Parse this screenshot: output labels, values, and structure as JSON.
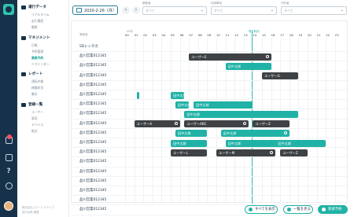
{
  "sidenav": {
    "sections": [
      {
        "title": "運行データ",
        "items": [
          "リアルタイム",
          "走行履歴",
          "動態"
        ]
      },
      {
        "title": "マネジメント",
        "items": [
          "日報",
          "予約管理",
          "乗務予約",
          "リマインダー"
        ]
      },
      {
        "title": "レポート",
        "items": [
          "運転作業",
          "稼働状況",
          "集計"
        ]
      },
      {
        "title": "登録一覧",
        "items": [
          "ユーザー",
          "車両",
          "デバイス",
          "拠点"
        ]
      }
    ],
    "active_item": "乗務予約",
    "footnote_company": "株式会社スマートドライブ",
    "footnote_user": "田中太郎 管理"
  },
  "filters": {
    "date": "2020-2-26（月）",
    "prev": "‹",
    "next": "›",
    "select1_label": "乗務者",
    "select1_value": "すべて",
    "select2_label": "利用車両",
    "select2_value": "すべて",
    "select3_label": "予約者",
    "select3_value": "すべて"
  },
  "timeline": {
    "column_header": "乗務者",
    "sub_label": "00時",
    "now_label": "現在時刻",
    "hours": [
      "00",
      "01",
      "02",
      "03",
      "04",
      "05",
      "06",
      "07",
      "08",
      "09",
      "10",
      "11",
      "12",
      "13",
      "14",
      "15",
      "16",
      "17",
      "18",
      "19",
      "20",
      "21",
      "22",
      "23"
    ],
    "rows": [
      "SDレンタカ",
      "品川営業012345",
      "品川営業012345",
      "品川営業012345",
      "品川営業012345",
      "品川営業012345",
      "品川営業012345",
      "品川営業012345",
      "品川営業012345",
      "品川営業012345",
      "品川営業012345",
      "品川営業012345",
      "品川営業012345",
      "品川営業012345",
      "品川営業012345",
      "品川営業012345",
      "品川営業012345",
      "品川営業012345",
      "品川営業012345"
    ],
    "bars": [
      {
        "row": 1,
        "start": 7,
        "end": 16,
        "label": "ユーザーE",
        "color": "dark",
        "icon": true
      },
      {
        "row": 2,
        "start": 11,
        "end": 16,
        "label": "田中太郎",
        "color": "teal"
      },
      {
        "row": 3,
        "start": 15,
        "end": 19,
        "label": "ユーザーG",
        "color": "dark"
      },
      {
        "row": 5,
        "start": 1.3,
        "end": 1.5,
        "label": "",
        "color": "teal"
      },
      {
        "row": 5,
        "start": 5,
        "end": 6.5,
        "label": "田中太郎",
        "color": "teal"
      },
      {
        "row": 6,
        "start": 5.5,
        "end": 7,
        "label": "田中太郎",
        "color": "teal"
      },
      {
        "row": 6,
        "start": 7.5,
        "end": 14,
        "label": "田中太郎",
        "color": "teal"
      },
      {
        "row": 7,
        "start": 6.5,
        "end": 19,
        "label": "田中太郎",
        "color": "teal"
      },
      {
        "row": 8,
        "start": 1,
        "end": 6,
        "label": "ユーザーA",
        "color": "dark",
        "icon": true
      },
      {
        "row": 8,
        "start": 6.5,
        "end": 13.5,
        "label": "ユーザーABC",
        "color": "dark",
        "icon": true
      },
      {
        "row": 8,
        "start": 14,
        "end": 18,
        "label": "ユーザーZ",
        "color": "dark"
      },
      {
        "row": 9,
        "start": 5.5,
        "end": 9,
        "label": "田中太郎",
        "color": "teal"
      },
      {
        "row": 9,
        "start": 10.5,
        "end": 18,
        "label": "田中太郎",
        "color": "teal",
        "icon": true
      },
      {
        "row": 10,
        "start": 5,
        "end": 9,
        "label": "田中太郎",
        "color": "teal"
      },
      {
        "row": 10,
        "start": 11,
        "end": 17,
        "label": "田中太郎",
        "color": "teal"
      },
      {
        "row": 10,
        "start": 16.5,
        "end": 22,
        "label": "田中太郎",
        "color": "teal"
      },
      {
        "row": 11,
        "start": 5,
        "end": 9,
        "label": "ユーザーL",
        "color": "dark"
      },
      {
        "row": 11,
        "start": 10,
        "end": 16.5,
        "label": "ユーザーM",
        "color": "dark",
        "icon": true
      },
      {
        "row": 11,
        "start": 17,
        "end": 20,
        "label": "ユーザーZ",
        "color": "dark"
      }
    ]
  },
  "actions": {
    "show_all": "すべてを表示",
    "list_view": "一覧を見る",
    "new_booking": "新規予約"
  },
  "colors": {
    "teal": "#20b2a6",
    "dark": "#3f4245",
    "nav": "#16324a"
  }
}
